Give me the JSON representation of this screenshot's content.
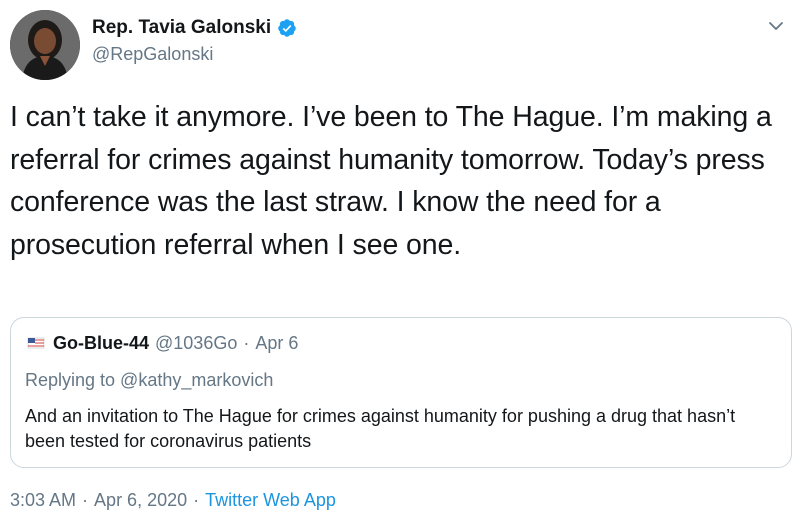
{
  "author": {
    "display_name": "Rep. Tavia Galonski",
    "handle": "@RepGalonski"
  },
  "tweet": {
    "text": "I can’t take it anymore. I’ve been to The Hague. I’m making a referral for crimes against humanity tomorrow. Today’s press conference was the last straw. I know the need for a prosecution referral when I see one."
  },
  "quoted_tweet": {
    "display_name": "Go-Blue-44",
    "handle": "@1036Go",
    "separator": "·",
    "date": "Apr 6",
    "replying_to": "Replying to @kathy_markovich",
    "text": "And an invitation to The Hague for crimes against humanity for pushing a drug that hasn’t been tested for coronavirus patients"
  },
  "meta": {
    "time": "3:03 AM",
    "sep1": "·",
    "date": "Apr 6, 2020",
    "sep2": "·",
    "source": "Twitter Web App"
  },
  "colors": {
    "text": "#14171a",
    "secondary": "#657786",
    "link": "#1b95e0",
    "verified": "#1da1f2",
    "border": "#ccd6dd"
  },
  "icons": [
    "verified-badge-icon",
    "chevron-down-icon"
  ]
}
